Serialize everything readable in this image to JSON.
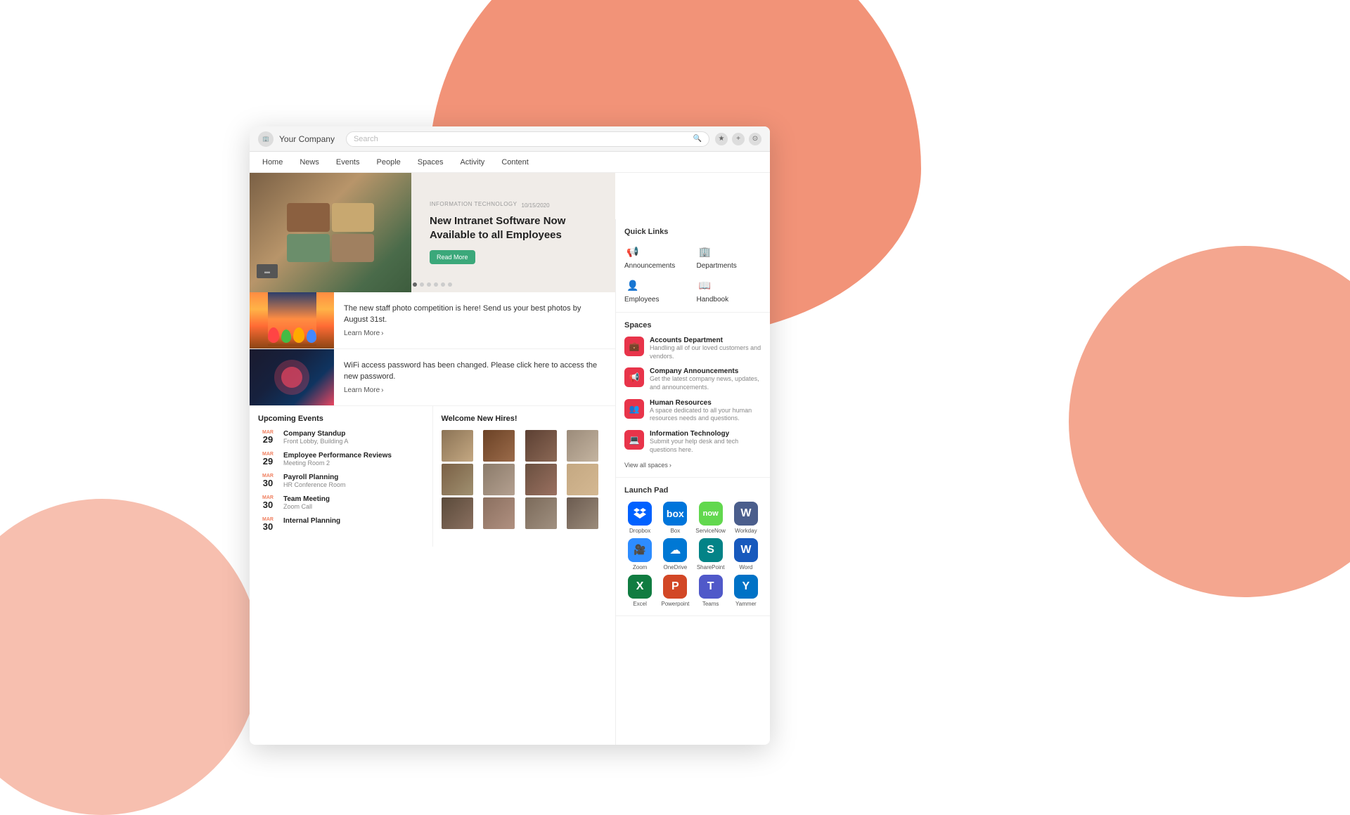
{
  "background": {
    "blob_color": "#F08060"
  },
  "browser": {
    "company": "Your Company",
    "search_placeholder": "Search",
    "icons": [
      "★",
      "+",
      "⊙"
    ]
  },
  "nav": {
    "items": [
      "Home",
      "News",
      "Events",
      "People",
      "Spaces",
      "Activity",
      "Content"
    ]
  },
  "hero": {
    "category": "INFORMATION TECHNOLOGY",
    "date": "10/15/2020",
    "title": "New Intranet Software Now Available to all Employees",
    "cta": "Read More",
    "dots": 6
  },
  "news": [
    {
      "type": "balloons",
      "text": "The new staff photo competition is here! Send us your best photos by August 31st.",
      "link": "Learn More"
    },
    {
      "type": "tech",
      "text": "WiFi access password has been changed. Please click here to access the new password.",
      "link": "Learn More"
    }
  ],
  "events": {
    "title": "Upcoming Events",
    "items": [
      {
        "month": "MAR",
        "day": "29",
        "name": "Company Standup",
        "location": "Front Lobby, Building A"
      },
      {
        "month": "MAR",
        "day": "29",
        "name": "Employee Performance Reviews",
        "location": "Meeting Room 2"
      },
      {
        "month": "MAR",
        "day": "30",
        "name": "Payroll Planning",
        "location": "HR Conference Room"
      },
      {
        "month": "MAR",
        "day": "30",
        "name": "Team Meeting",
        "location": "Zoom Call"
      },
      {
        "month": "MAR",
        "day": "30",
        "name": "Internal Planning",
        "location": ""
      }
    ]
  },
  "new_hires": {
    "title": "Welcome New Hires!",
    "count": 12
  },
  "quick_links": {
    "title": "Quick Links",
    "items": [
      {
        "icon": "📢",
        "label": "Announcements",
        "color": "#F08060"
      },
      {
        "icon": "🏢",
        "label": "Departments",
        "color": "#F08060"
      },
      {
        "icon": "👤",
        "label": "Employees",
        "color": "#F08060"
      },
      {
        "icon": "📖",
        "label": "Handbook",
        "color": "#E8344A"
      }
    ]
  },
  "spaces": {
    "title": "Spaces",
    "items": [
      {
        "name": "Accounts Department",
        "desc": "Handling all of our loved customers and vendors.",
        "icon": "💼",
        "color": "#E8344A"
      },
      {
        "name": "Company Announcements",
        "desc": "Get the latest company news, updates, and announcements.",
        "icon": "📢",
        "color": "#E8344A"
      },
      {
        "name": "Human Resources",
        "desc": "A space dedicated to all your human resources needs and questions.",
        "icon": "👥",
        "color": "#E8344A"
      },
      {
        "name": "Information Technology",
        "desc": "Submit your help desk and tech questions here.",
        "icon": "💻",
        "color": "#E8344A"
      }
    ],
    "view_all": "View all spaces"
  },
  "launchpad": {
    "title": "Launch Pad",
    "apps": [
      {
        "name": "Dropbox",
        "class": "app-dropbox",
        "icon": "◈"
      },
      {
        "name": "Box",
        "class": "app-box",
        "icon": "⬜"
      },
      {
        "name": "ServiceNow",
        "class": "app-servicenow",
        "icon": "⚡"
      },
      {
        "name": "Workday",
        "class": "app-workday",
        "icon": "W"
      },
      {
        "name": "Zoom",
        "class": "app-zoom",
        "icon": "🎥"
      },
      {
        "name": "OneDrive",
        "class": "app-onedrive",
        "icon": "☁"
      },
      {
        "name": "SharePoint",
        "class": "app-sharepoint",
        "icon": "S"
      },
      {
        "name": "Word",
        "class": "app-word",
        "icon": "W"
      },
      {
        "name": "Excel",
        "class": "app-excel",
        "icon": "X"
      },
      {
        "name": "Powerpoint",
        "class": "app-powerpoint",
        "icon": "P"
      },
      {
        "name": "Teams",
        "class": "app-teams",
        "icon": "T"
      },
      {
        "name": "Yammer",
        "class": "app-yammer",
        "icon": "Y"
      }
    ]
  }
}
